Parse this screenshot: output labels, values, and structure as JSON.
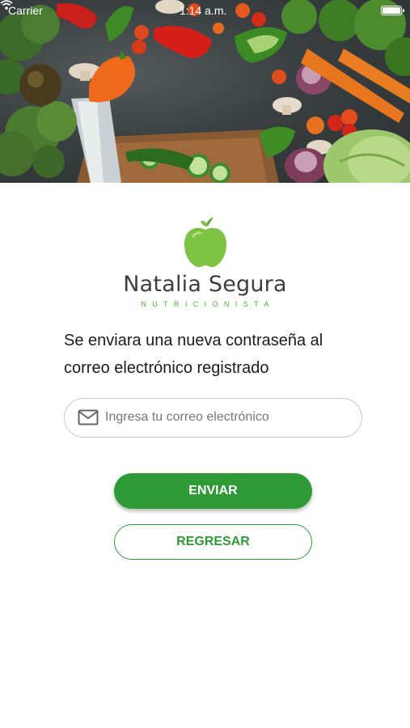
{
  "status_bar": {
    "carrier": "Carrier",
    "time": "1:14 a.m."
  },
  "logo": {
    "name": "Natalia Segura",
    "subtitle": "NUTRICIONISTA"
  },
  "instruction": {
    "line1": "Se enviara una nueva contraseña al",
    "line2": "correo electrónico registrado"
  },
  "email_field": {
    "placeholder": "Ingresa tu correo electrónico",
    "value": "",
    "icon": "mail-icon"
  },
  "buttons": {
    "send_label": "ENVIAR",
    "back_label": "REGRESAR"
  },
  "colors": {
    "primary_green": "#2e9a36",
    "apple_green": "#7dc242",
    "text_dark": "#1b1b1b",
    "logo_text": "#3e3e3e",
    "field_border": "#c8c8c8"
  }
}
